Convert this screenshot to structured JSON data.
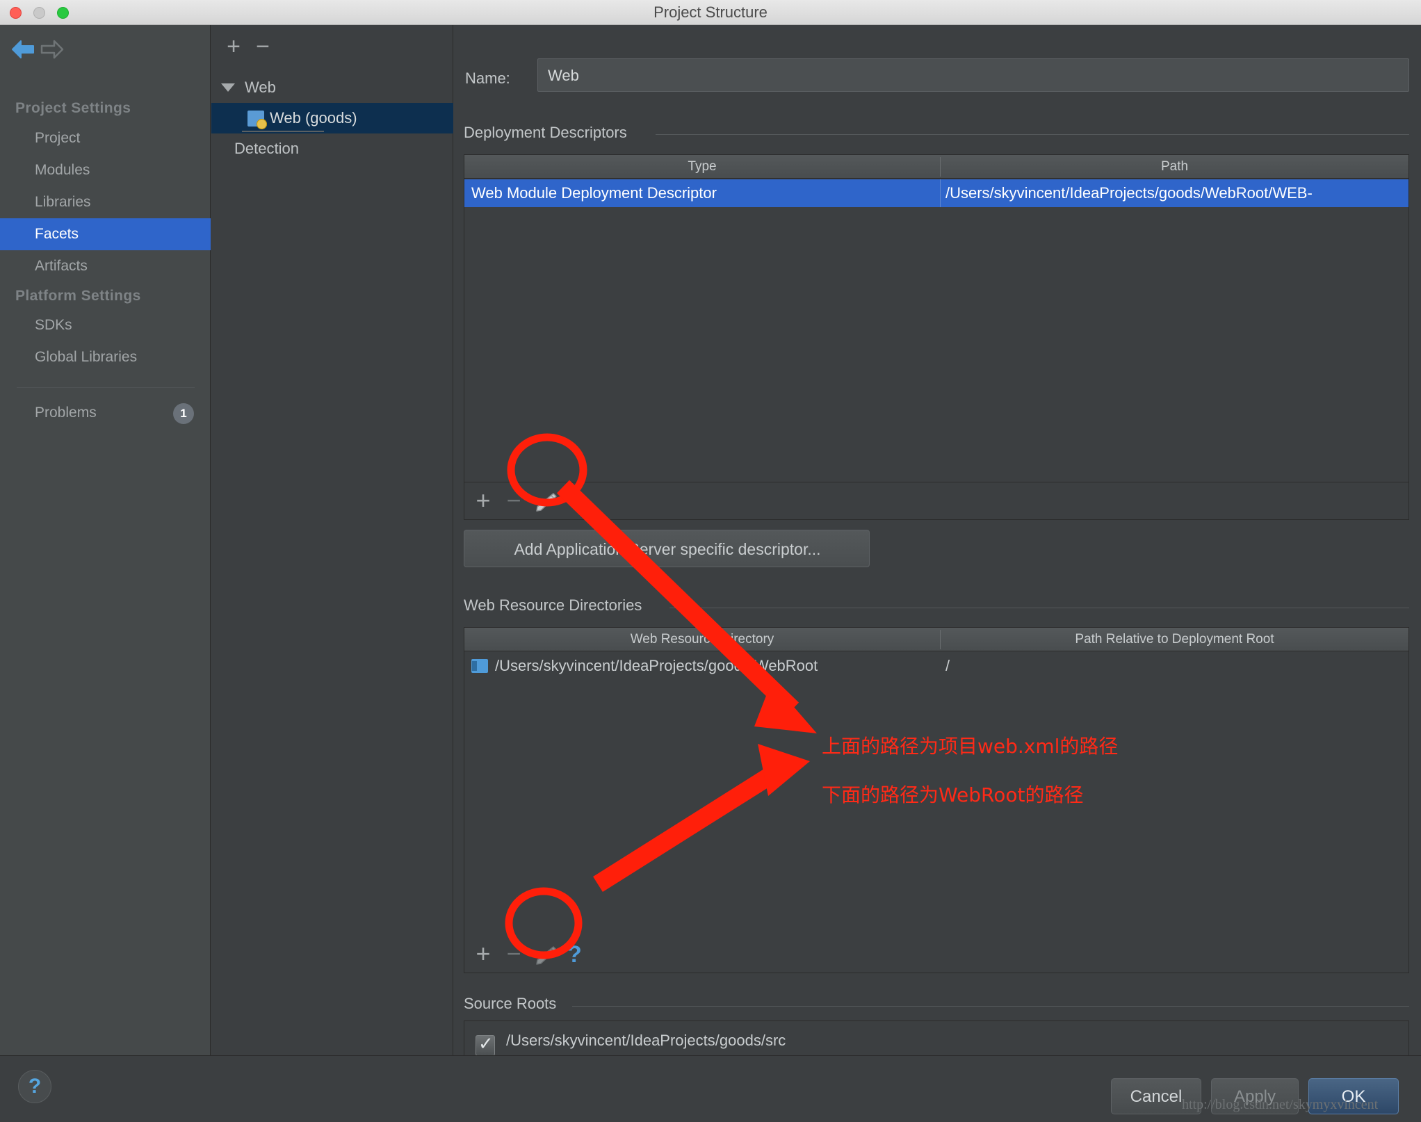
{
  "window": {
    "title": "Project Structure",
    "controls": [
      "close",
      "minimize",
      "maximize"
    ]
  },
  "sidebar": {
    "nav": {
      "back_icon": "arrow-left-icon",
      "forward_icon": "arrow-right-icon"
    },
    "groups": [
      {
        "label": "Project Settings",
        "items": [
          "Project",
          "Modules",
          "Libraries",
          "Facets",
          "Artifacts"
        ]
      },
      {
        "label": "Platform Settings",
        "items": [
          "SDKs",
          "Global Libraries"
        ]
      }
    ],
    "selected": "Facets",
    "problems": {
      "label": "Problems",
      "count": "1"
    }
  },
  "tree": {
    "toolbar": {
      "add": "+",
      "remove": "−"
    },
    "nodes": [
      {
        "label": "Web",
        "type": "group",
        "expanded": true
      },
      {
        "label": "Web (goods)",
        "type": "facet",
        "selected": true
      },
      {
        "label": "Detection",
        "type": "group"
      }
    ]
  },
  "main": {
    "name": {
      "label": "Name:",
      "value": "Web"
    },
    "deployment_descriptors": {
      "title": "Deployment Descriptors",
      "columns": [
        "Type",
        "Path"
      ],
      "rows": [
        {
          "type": "Web Module Deployment Descriptor",
          "path": "/Users/skyvincent/IdeaProjects/goods/WebRoot/WEB-",
          "selected": true
        }
      ],
      "toolbar": {
        "add": "+",
        "remove": "−",
        "edit": "pencil-icon"
      },
      "add_button": "Add Application Server specific descriptor..."
    },
    "web_resource_directories": {
      "title": "Web Resource Directories",
      "columns": [
        "Web Resource Directory",
        "Path Relative to Deployment Root"
      ],
      "rows": [
        {
          "directory": "/Users/skyvincent/IdeaProjects/goods/WebRoot",
          "relative_path": "/"
        }
      ],
      "toolbar": {
        "add": "+",
        "remove": "−",
        "edit": "pencil-icon",
        "help": "?"
      }
    },
    "source_roots": {
      "title": "Source Roots",
      "rows": [
        {
          "checked": true,
          "path": "/Users/skyvincent/IdeaProjects/goods/src"
        }
      ]
    }
  },
  "annotations": {
    "note_top": "上面的路径为项目web.xml的路径",
    "note_bottom": "下面的路径为WebRoot的路径",
    "color": "#ff2a17"
  },
  "footer": {
    "help": "?",
    "buttons": {
      "cancel": "Cancel",
      "apply": "Apply",
      "ok": "OK"
    },
    "watermark": "http://blog.csdn.net/skymyxvincent"
  }
}
